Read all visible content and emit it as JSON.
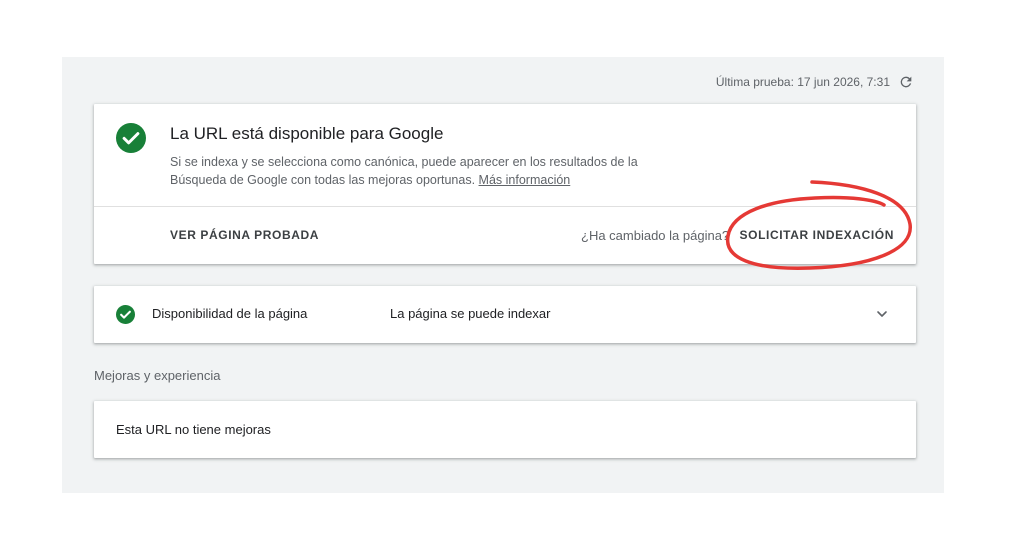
{
  "header": {
    "last_test": "Última prueba: 17 jun 2026, 7:31",
    "refresh_icon": "refresh-icon"
  },
  "status_card": {
    "icon": "check-circle-icon",
    "icon_color": "#188038",
    "title": "La URL está disponible para Google",
    "description": "Si se indexa y se selecciona como canónica, puede aparecer en los resultados de la Búsqueda de Google con todas las mejoras oportunas.",
    "more_info_link": "Más información",
    "view_tested_page": "VER PÁGINA PROBADA",
    "changed_question": "¿Ha cambiado la página?",
    "request_indexing": "SOLICITAR INDEXACIÓN",
    "annotation_color": "#e53935"
  },
  "availability": {
    "icon": "check-circle-icon",
    "label": "Disponibilidad de la página",
    "value": "La página se puede indexar",
    "expand_icon": "chevron-down-icon"
  },
  "enhancements": {
    "section_label": "Mejoras y experiencia",
    "empty_text": "Esta URL no tiene mejoras"
  }
}
